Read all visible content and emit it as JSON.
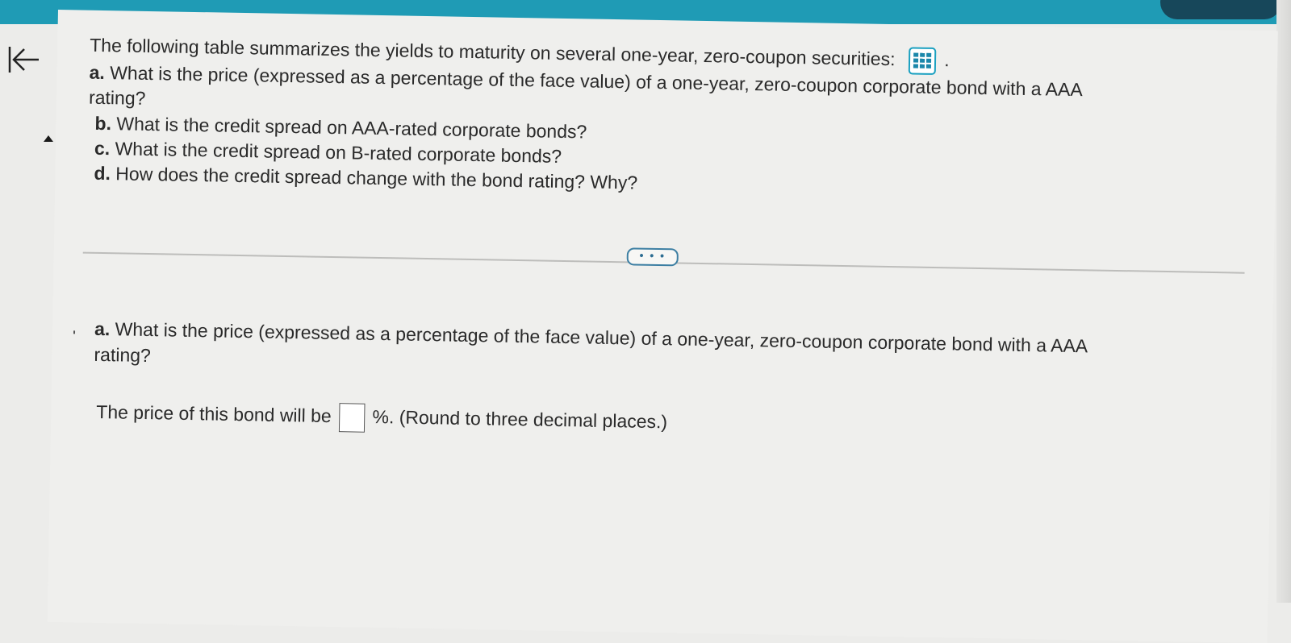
{
  "question": {
    "intro": "The following table summarizes the yields to maturity on several one-year, zero-coupon securities:",
    "intro_icon": "data-table-icon",
    "intro_suffix": ".",
    "part_a_label": "a.",
    "part_a_line1": "What is the price (expressed as a percentage of the face value) of a one-year, zero-coupon corporate bond with a AAA",
    "part_a_line2": "rating?",
    "part_b_label": "b.",
    "part_b_text": "What is the credit spread on AAA-rated corporate bonds?",
    "part_c_label": "c.",
    "part_c_text": "What is the credit spread on B-rated corporate bonds?",
    "part_d_label": "d.",
    "part_d_text": "How does the credit spread change with the bond rating? Why?"
  },
  "more_button": "• • •",
  "answer_section": {
    "label": "a.",
    "question_line1": "What is the price (expressed as a percentage of the face value) of a one-year, zero-coupon corporate bond with a AAA",
    "question_line2": "rating?",
    "prompt_before": "The price of this bond will be",
    "prompt_after": "%.  (Round to three decimal places.)",
    "answer_value": ""
  },
  "colors": {
    "top_bar": "#1f9bb5",
    "accent": "#1aa0c0"
  }
}
